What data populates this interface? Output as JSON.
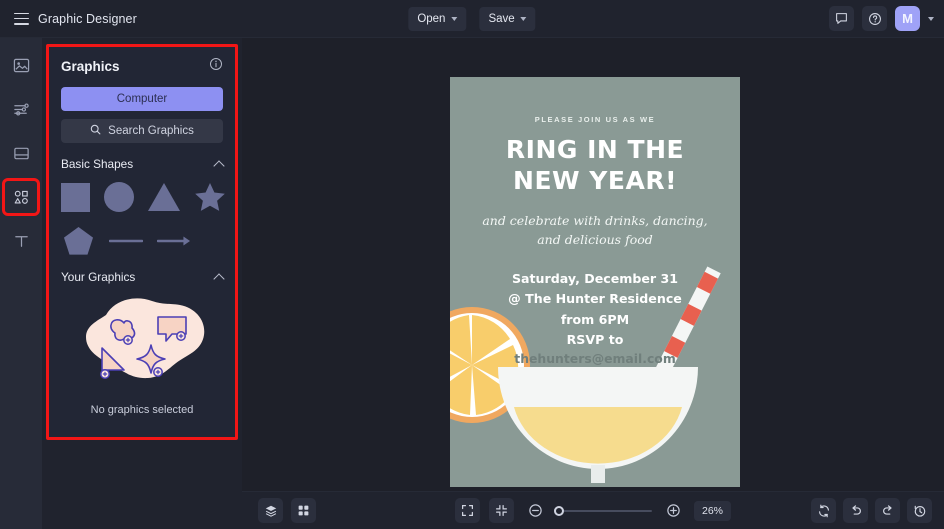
{
  "topbar": {
    "menu_icon": "hamburger-icon",
    "app_title": "Graphic Designer",
    "open_label": "Open",
    "save_label": "Save",
    "comment_icon": "comment-icon",
    "help_icon": "help-icon",
    "avatar_initial": "M",
    "avatar_color": "#9fa2f7"
  },
  "rail": {
    "items": [
      {
        "name": "image-icon",
        "active": false
      },
      {
        "name": "adjustments-icon",
        "active": false
      },
      {
        "name": "layout-icon",
        "active": false
      },
      {
        "name": "shapes-icon",
        "active": true
      },
      {
        "name": "text-icon",
        "active": false
      }
    ],
    "highlight_color": "#f21616"
  },
  "panel": {
    "title": "Graphics",
    "info_icon": "info-icon",
    "computer_button": "Computer",
    "computer_button_color": "#8d90f2",
    "search_placeholder": "Search Graphics",
    "search_icon": "search-icon",
    "sections": [
      {
        "label": "Basic Shapes",
        "chevron": "chevron-up-icon"
      },
      {
        "label": "Your Graphics",
        "chevron": "chevron-up-icon"
      }
    ],
    "shapes": [
      {
        "name": "square-shape"
      },
      {
        "name": "circle-shape"
      },
      {
        "name": "triangle-shape"
      },
      {
        "name": "star-shape"
      },
      {
        "name": "pentagon-shape"
      },
      {
        "name": "line-shape"
      },
      {
        "name": "arrow-shape"
      }
    ],
    "empty_state_text": "No graphics selected",
    "empty_state_illustration": "graphics-blob-illustration"
  },
  "canvas": {
    "background_color": "#8a9a95",
    "kicker": "PLEASE JOIN US AS WE",
    "title_line1": "RING IN THE",
    "title_line2": "NEW YEAR!",
    "subtitle_line1": "and celebrate with drinks, dancing,",
    "subtitle_line2": "and delicious food",
    "detail_line1": "Saturday, December 31",
    "detail_line2": "@ The Hunter Residence",
    "detail_line3": "from 6PM",
    "detail_line4": "RSVP to",
    "email": "thehunters@email.com",
    "illustration": "cocktail-glass-with-orange-slice",
    "drink_color": "#f6dc8e",
    "orange_color": "#f8cd6b",
    "straw_color": "#e8604f"
  },
  "bottombar": {
    "layers_icon": "layers-icon",
    "grid_icon": "grid-icon",
    "fit_screen_icon": "fit-screen-icon",
    "collapse_icon": "collapse-icon",
    "zoom_out_icon": "zoom-out-icon",
    "zoom_in_icon": "zoom-in-icon",
    "zoom_level": "26%",
    "refresh_icon": "refresh-icon",
    "undo_icon": "undo-icon",
    "redo_icon": "redo-icon",
    "history_icon": "history-icon"
  }
}
